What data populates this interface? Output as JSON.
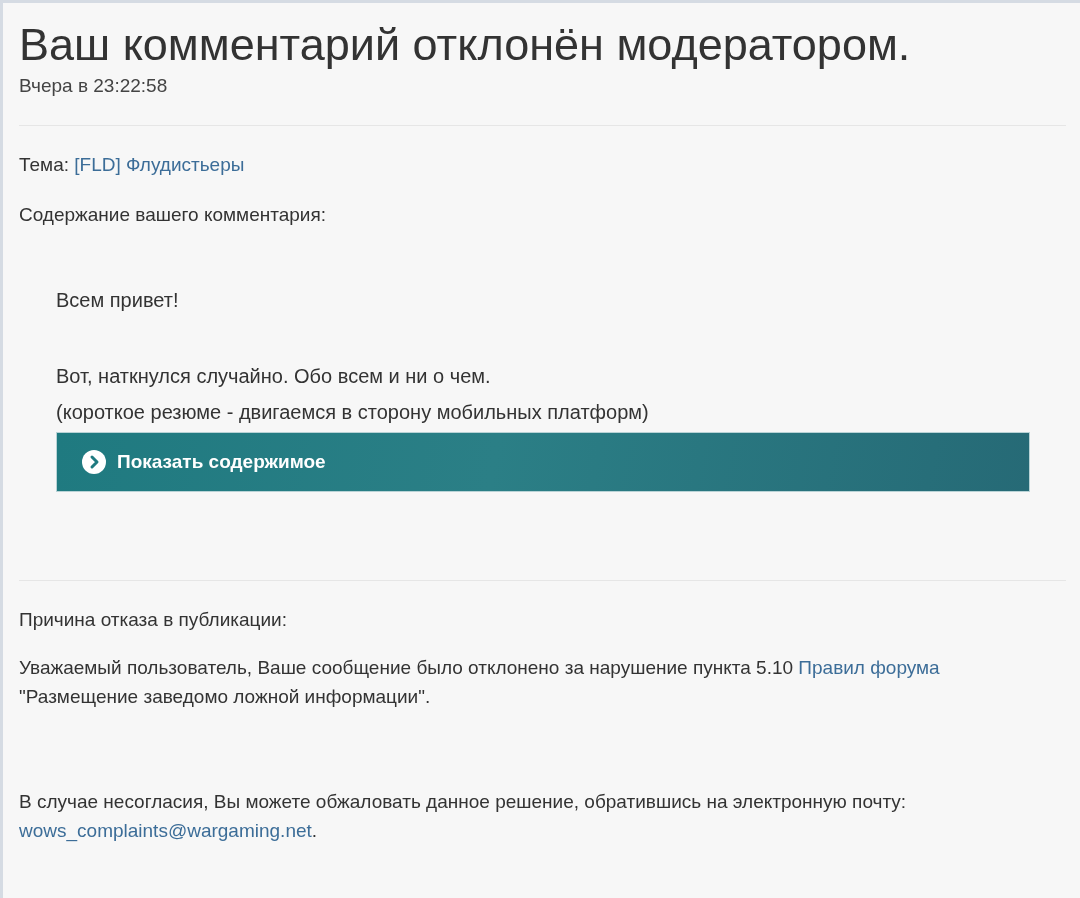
{
  "notification": {
    "title": "Ваш комментарий отклонён модератором.",
    "time": "Вчера в 23:22:58"
  },
  "topic": {
    "label": "Тема:",
    "link": "[FLD] Флудистьеры"
  },
  "content_label": "Содержание вашего комментария:",
  "comment": {
    "paragraphs": [
      [
        "Всем привет!"
      ],
      [
        "Вот, наткнулся случайно. Обо всем и ни о чем.",
        "(короткое резюме - двигаемся в сторону мобильных платформ)"
      ]
    ],
    "spoiler": {
      "label": "Показать содержимое",
      "expanded": false
    }
  },
  "reason_label": "Причина отказа в публикации:",
  "reason": [
    {
      "kind": "text",
      "text": "Уважаемый пользователь, Ваше сообщение было отклонено за нарушение пункта 5.10 "
    },
    {
      "kind": "link",
      "text": "Правил форума"
    },
    {
      "kind": "text",
      "text": " \"Размещение заведомо ложной информации\"."
    }
  ],
  "appeal": [
    {
      "kind": "text",
      "text": "В случае несогласия, Вы можете обжаловать данное решение, обратившись на электронную почту: "
    },
    {
      "kind": "link",
      "text": "wows_complaints@wargaming.net"
    },
    {
      "kind": "text",
      "text": "."
    }
  ]
}
